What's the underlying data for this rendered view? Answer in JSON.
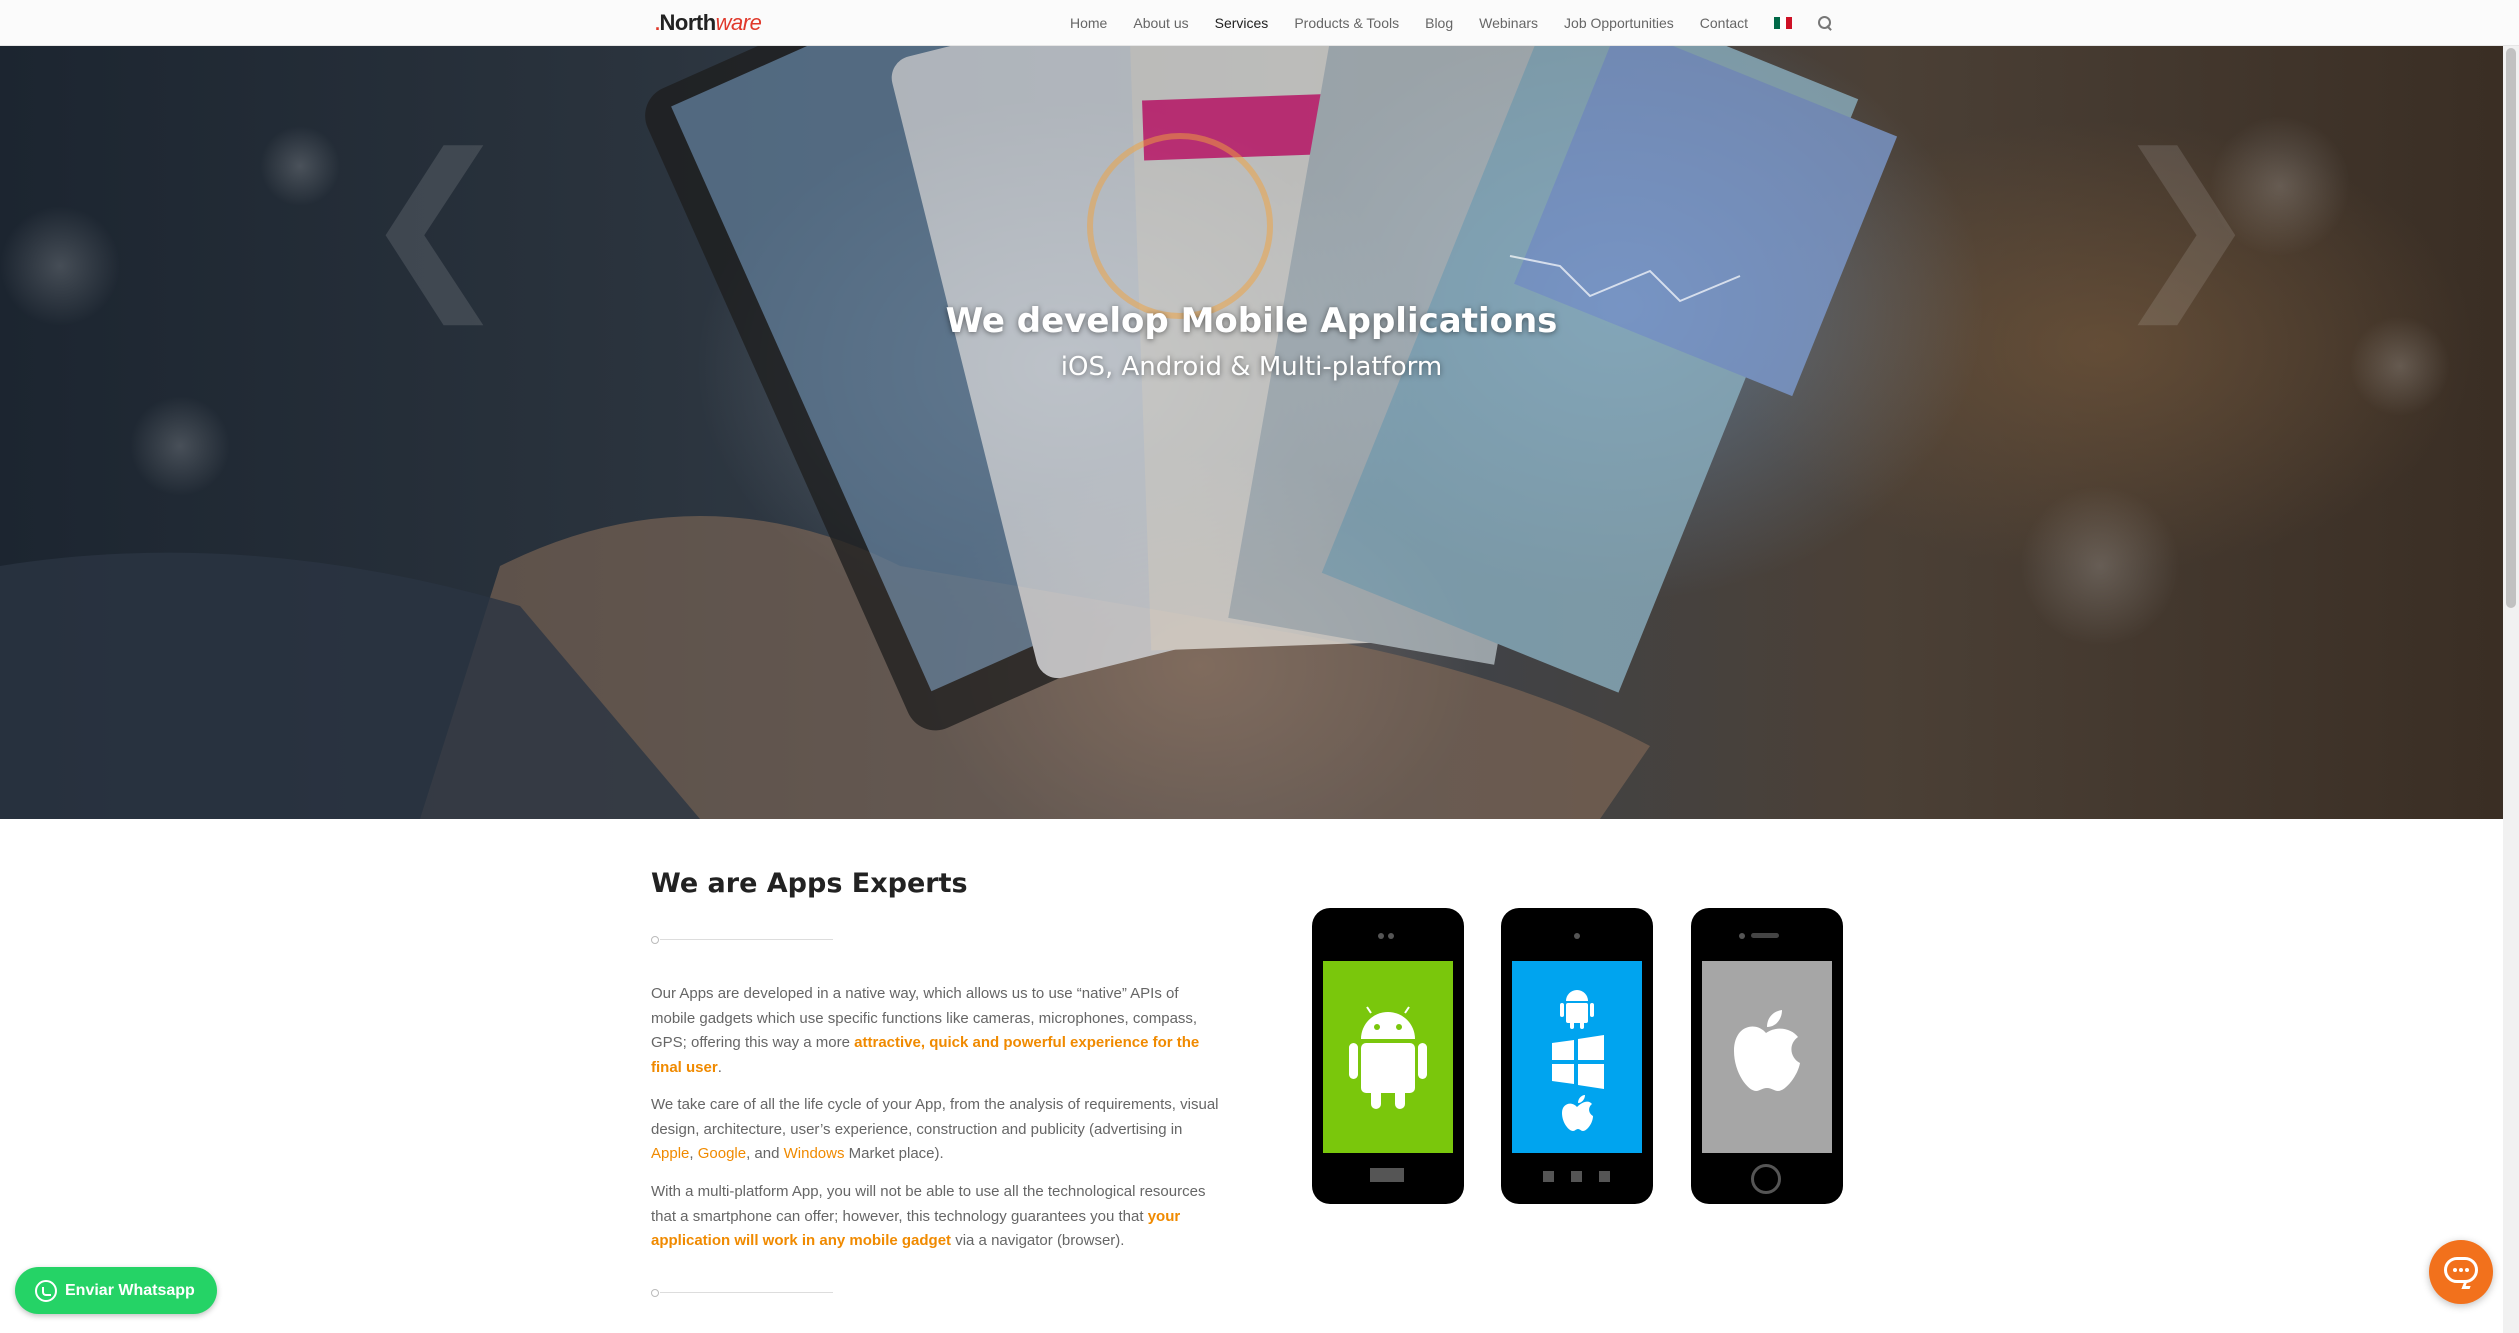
{
  "header": {
    "logo_prefix": ".",
    "logo_main": "North",
    "logo_suffix": "ware",
    "nav": [
      {
        "label": "Home"
      },
      {
        "label": "About us"
      },
      {
        "label": "Services"
      },
      {
        "label": "Products & Tools"
      },
      {
        "label": "Blog"
      },
      {
        "label": "Webinars"
      },
      {
        "label": "Job Opportunities"
      },
      {
        "label": "Contact"
      }
    ],
    "active_nav": "Services",
    "flag_colors": [
      "#006847",
      "#ffffff",
      "#ce1126"
    ]
  },
  "hero": {
    "title": "We develop Mobile Applications",
    "subtitle": "iOS, Android & Multi-platform",
    "prev_arrow": "❮",
    "next_arrow": "❯"
  },
  "main": {
    "section_title": "We are Apps Experts",
    "p1": {
      "text": "Our Apps are developed in a native way, which allows us to use “native” APIs of mobile gadgets which use specific functions like cameras, microphones, compass, GPS; offering this way a more ",
      "link": "attractive, quick and powerful experience for the final user",
      "end": "."
    },
    "p2": {
      "text": "We take care of all the life cycle of your App, from the analysis of requirements, visual design, architecture, user’s experience, construction and publicity (advertising in ",
      "link1": "Apple",
      "sep1": ", ",
      "link2": "Google",
      "sep2": ", and ",
      "link3": "Windows",
      "end": " Market place)."
    },
    "p3": {
      "text": "With a multi-platform App, you will not be able to use all the technological resources that a smartphone can offer; however, this technology guarantees you that ",
      "link": "your application will work in any mobile gadget",
      "end": " via a navigator (browser)."
    },
    "devices": [
      {
        "name": "android",
        "screen_color": "#7ac70c",
        "icon": "android-icon"
      },
      {
        "name": "multi",
        "screen_color": "#00a4ef",
        "icon": "multi-platform-icons"
      },
      {
        "name": "ios",
        "screen_color": "#a6a6a6",
        "icon": "apple-icon"
      }
    ]
  },
  "floating": {
    "whatsapp_label": "Enviar Whatsapp",
    "whatsapp_color": "#25d366",
    "chat_color": "#f2711c"
  },
  "colors": {
    "accent": "#f08a00",
    "text": "#666666",
    "heading": "#222222"
  }
}
